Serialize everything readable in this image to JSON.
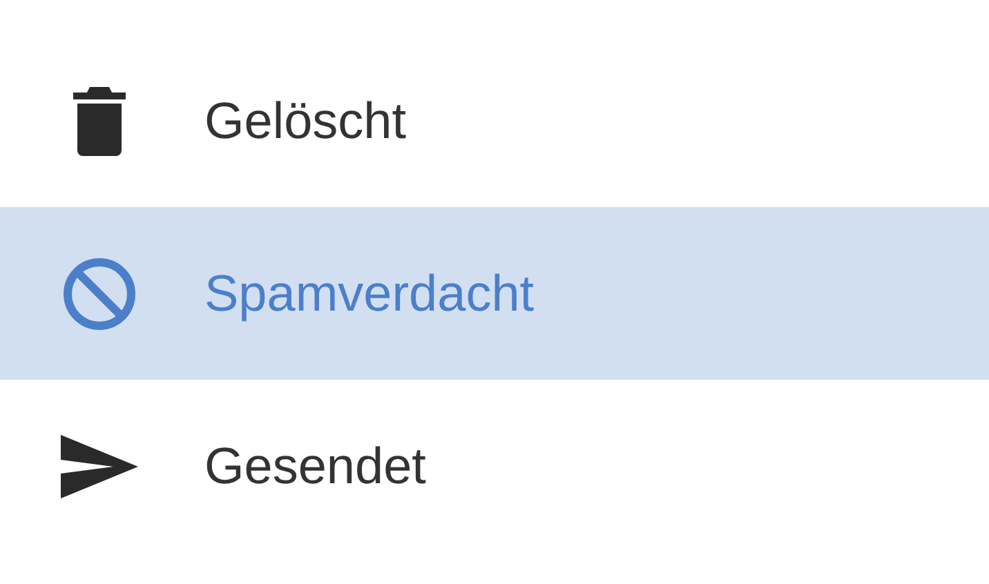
{
  "folders": [
    {
      "label": "Gelöscht",
      "kind": "trash",
      "selected": false
    },
    {
      "label": "Spamverdacht",
      "kind": "spam",
      "selected": true
    },
    {
      "label": "Gesendet",
      "kind": "sent",
      "selected": false
    }
  ]
}
